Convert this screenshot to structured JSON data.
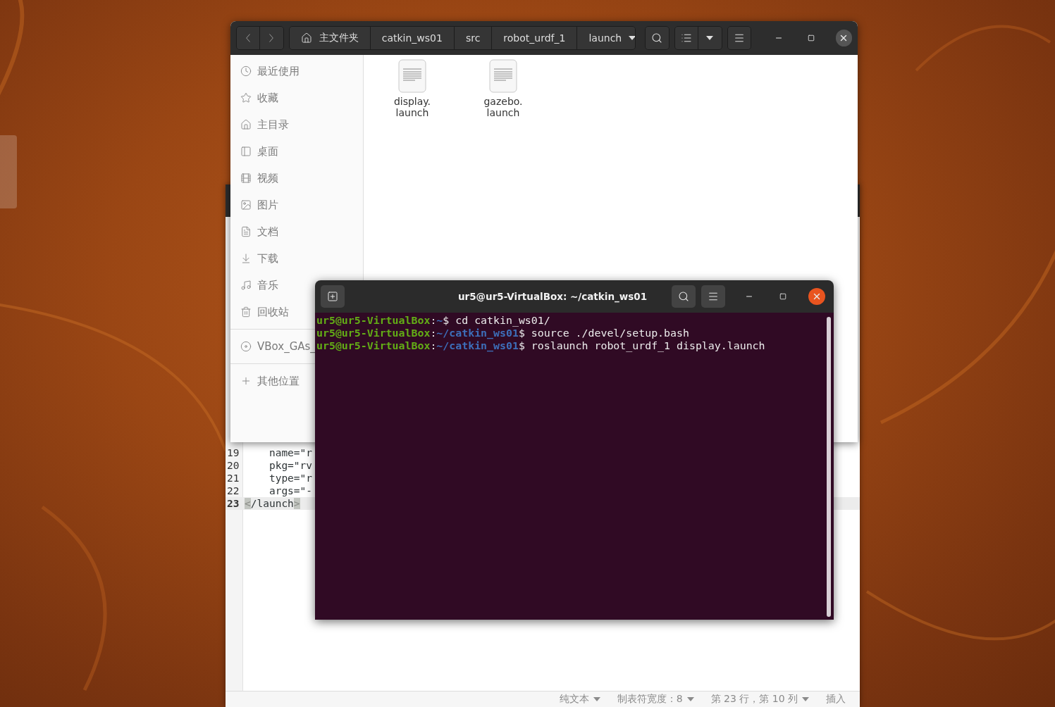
{
  "file_manager": {
    "path": [
      {
        "label": "主文件夹",
        "kind": "home"
      },
      {
        "label": "catkin_ws01",
        "kind": "folder"
      },
      {
        "label": "src",
        "kind": "folder"
      },
      {
        "label": "robot_urdf_1",
        "kind": "folder"
      },
      {
        "label": "launch",
        "kind": "current"
      }
    ],
    "sidebar": {
      "places": [
        "最近使用",
        "收藏",
        "主目录",
        "桌面",
        "视频",
        "图片",
        "文档",
        "下载",
        "音乐",
        "回收站"
      ],
      "devices": [
        "VBox_GAs_"
      ],
      "other": [
        "其他位置"
      ]
    },
    "files": [
      {
        "name_lines": [
          "display.",
          "launch"
        ]
      },
      {
        "name_lines": [
          "gazebo.",
          "launch"
        ]
      }
    ]
  },
  "editor": {
    "lines": [
      {
        "number": "19",
        "current": false,
        "segments": [
          {
            "text": "    name=\"r",
            "kind": "text"
          }
        ]
      },
      {
        "number": "20",
        "current": false,
        "segments": [
          {
            "text": "    pkg=\"rv",
            "kind": "text"
          }
        ]
      },
      {
        "number": "21",
        "current": false,
        "segments": [
          {
            "text": "    type=\"r",
            "kind": "text"
          }
        ]
      },
      {
        "number": "22",
        "current": false,
        "segments": [
          {
            "text": "    args=\"-",
            "kind": "text"
          }
        ]
      },
      {
        "number": "23",
        "current": true,
        "segments": [
          {
            "text": "<",
            "kind": "bracket"
          },
          {
            "text": "/launch",
            "kind": "text"
          },
          {
            "text": ">",
            "kind": "bracket"
          }
        ]
      }
    ],
    "status_bar": [
      {
        "label": "纯文本",
        "dropdown": true
      },
      {
        "label": "制表符宽度：8",
        "dropdown": true
      },
      {
        "label": "第 23 行，第 10 列",
        "dropdown": true
      },
      {
        "label": "插入",
        "dropdown": false
      }
    ]
  },
  "terminal": {
    "title": "ur5@ur5-VirtualBox: ~/catkin_ws01",
    "lines": [
      {
        "segments": [
          {
            "text": "ur5@ur5-VirtualBox",
            "kind": "user"
          },
          {
            "text": ":",
            "kind": "plain"
          },
          {
            "text": "~",
            "kind": "path"
          },
          {
            "text": "$ cd catkin_ws01/",
            "kind": "plain"
          }
        ]
      },
      {
        "segments": [
          {
            "text": "ur5@ur5-VirtualBox",
            "kind": "user"
          },
          {
            "text": ":",
            "kind": "plain"
          },
          {
            "text": "~/catkin_ws01",
            "kind": "path"
          },
          {
            "text": "$ source ./devel/setup.bash",
            "kind": "plain"
          }
        ]
      },
      {
        "segments": [
          {
            "text": "ur5@ur5-VirtualBox",
            "kind": "user"
          },
          {
            "text": ":",
            "kind": "plain"
          },
          {
            "text": "~/catkin_ws01",
            "kind": "path"
          },
          {
            "text": "$ roslaunch robot_urdf_1 display.launch",
            "kind": "plain"
          }
        ]
      }
    ]
  }
}
